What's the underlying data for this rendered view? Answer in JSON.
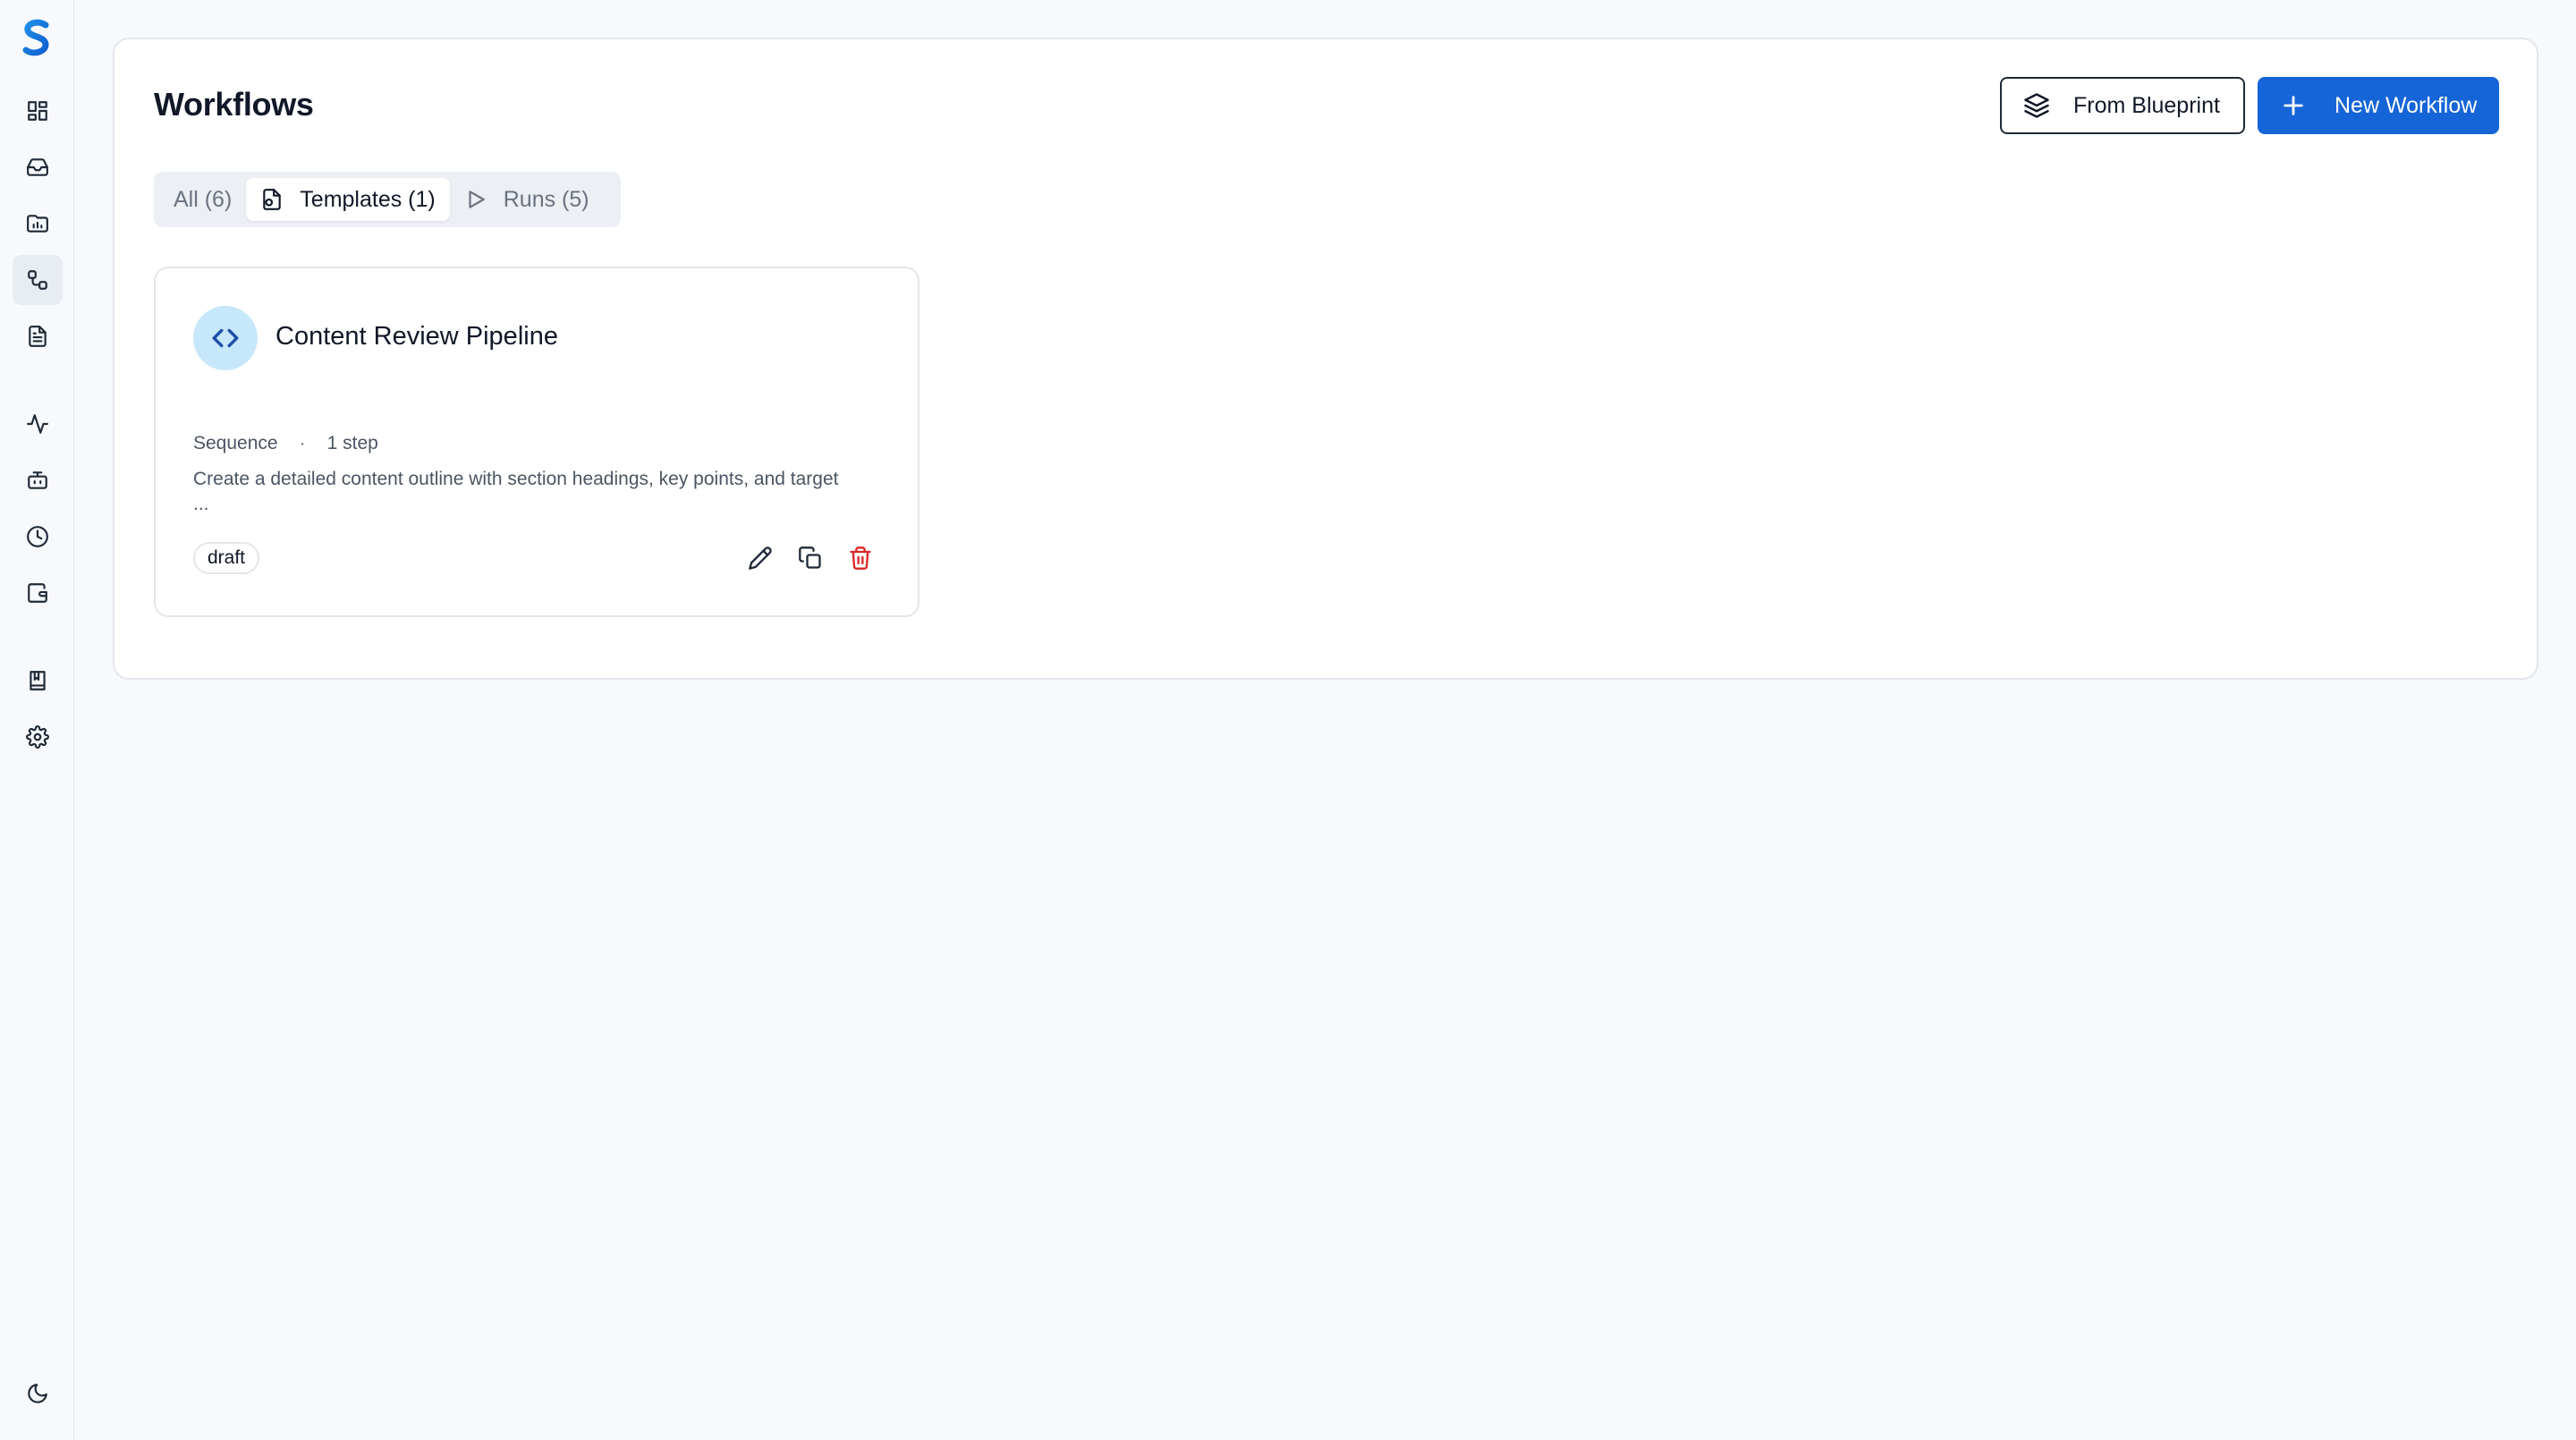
{
  "sidebar": {
    "items": [
      {
        "icon": "dashboard-icon",
        "active": false
      },
      {
        "icon": "inbox-icon",
        "active": false
      },
      {
        "icon": "folder-icon",
        "active": false
      },
      {
        "icon": "workflow-icon",
        "active": true
      },
      {
        "icon": "document-icon",
        "active": false
      },
      {
        "icon": "activity-icon",
        "active": false
      },
      {
        "icon": "bot-icon",
        "active": false
      },
      {
        "icon": "clock-icon",
        "active": false
      },
      {
        "icon": "wallet-icon",
        "active": false
      },
      {
        "icon": "book-icon",
        "active": false
      },
      {
        "icon": "settings-icon",
        "active": false
      },
      {
        "icon": "moon-icon",
        "active": false
      }
    ]
  },
  "header": {
    "title": "Workflows",
    "from_blueprint_label": "From Blueprint",
    "new_workflow_label": "New Workflow"
  },
  "tabs": [
    {
      "label": "All (6)",
      "active": false
    },
    {
      "label": "Templates (1)",
      "active": true,
      "icon": "template-icon"
    },
    {
      "label": "Runs (5)",
      "active": false,
      "icon": "play-icon"
    }
  ],
  "workflows": [
    {
      "title": "Content Review Pipeline",
      "icon": "code-icon",
      "type": "Sequence",
      "steps": "1 step",
      "separator": "·",
      "description": "Create a detailed content outline with section headings, key points, and target ...",
      "status": "draft"
    }
  ],
  "colors": {
    "primary": "#1565d8",
    "danger": "#dc2626",
    "icon_bg": "#c7e7fb",
    "page_bg": "#f7f9fc"
  }
}
